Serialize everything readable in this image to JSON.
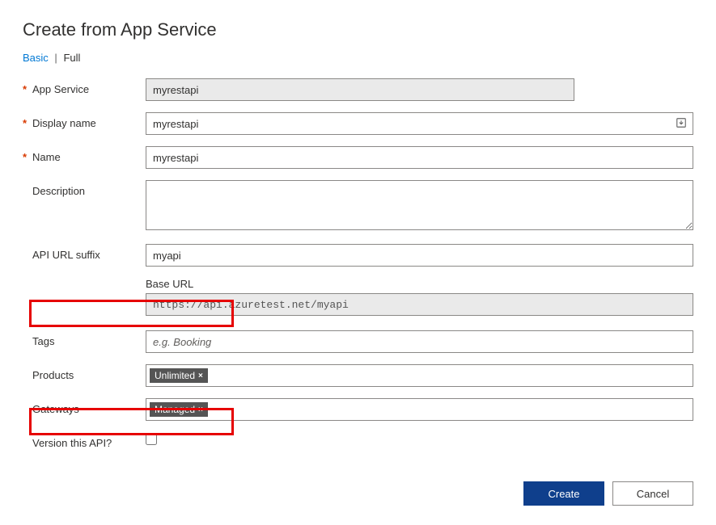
{
  "header": {
    "title": "Create from App Service"
  },
  "tabs": {
    "basic": "Basic",
    "full": "Full",
    "separator": "|"
  },
  "fields": {
    "app_service": {
      "label": "App Service",
      "value": "myrestapi"
    },
    "display_name": {
      "label": "Display name",
      "value": "myrestapi"
    },
    "name": {
      "label": "Name",
      "value": "myrestapi"
    },
    "description": {
      "label": "Description",
      "value": ""
    },
    "api_url_suffix": {
      "label": "API URL suffix",
      "value": "myapi"
    },
    "base_url": {
      "label": "Base URL",
      "value": "https://api.azuretest.net/myapi"
    },
    "tags": {
      "label": "Tags",
      "placeholder": "e.g. Booking",
      "value": ""
    },
    "products": {
      "label": "Products",
      "chip": "Unlimited"
    },
    "gateways": {
      "label": "Gateways",
      "chip": "Managed"
    },
    "version_api": {
      "label": "Version this API?"
    }
  },
  "buttons": {
    "create": "Create",
    "cancel": "Cancel"
  }
}
